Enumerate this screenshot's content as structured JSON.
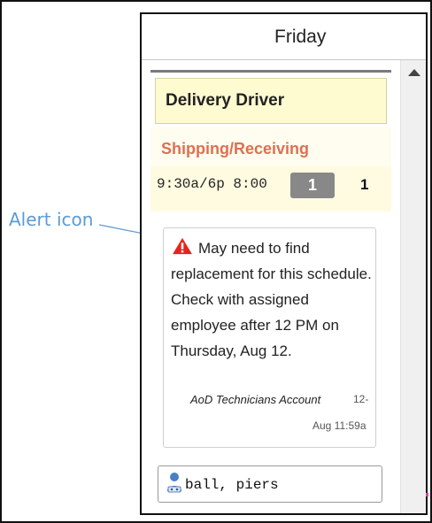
{
  "callout": {
    "label": "Alert icon"
  },
  "day": {
    "title": "Friday"
  },
  "job": {
    "title": "Delivery Driver",
    "department": "Shipping/Receiving",
    "schedule": "9:30a/6p 8:00",
    "badge_count": "1",
    "count": "1"
  },
  "note": {
    "icon": "alert-triangle",
    "icon_color": "#e8231a",
    "text": "May need to find replacement for this schedule. Check with assigned employee after 12 PM on Thursday, Aug 12.",
    "author": "AoD Technicians Account",
    "date_part1": "12-",
    "date_part2": "Aug 11:59a"
  },
  "employee": {
    "icon": "person-icon",
    "name": "ball, piers"
  },
  "colors": {
    "callout": "#5b9bd5",
    "job_card_bg": "#fffbd0",
    "department": "#dd7052",
    "badge_bg": "#888888"
  }
}
